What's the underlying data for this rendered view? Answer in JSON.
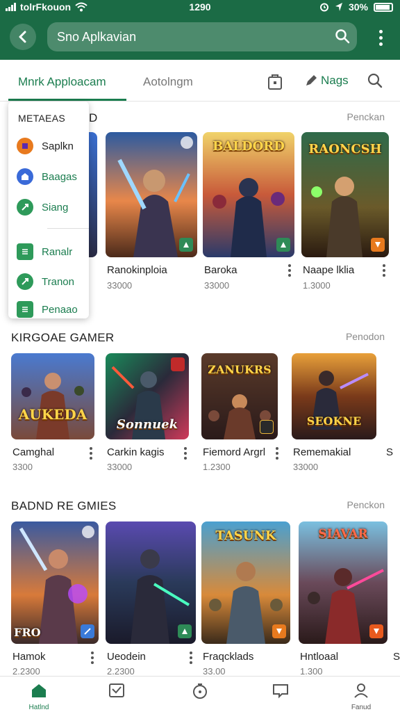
{
  "status_bar": {
    "carrier": "tolrFkouon",
    "time": "1290",
    "battery": "30%"
  },
  "header": {
    "search_text": "Sno Aplkavian",
    "back_icon": "back-arrow-icon",
    "search_icon": "search-icon",
    "menu_icon": "more-vert-icon",
    "color": "#1b6b45"
  },
  "tabs": {
    "active": "Mnrk Apploacam",
    "second": "Aotolngm",
    "nags": "Nags",
    "accent": "#1b7d4f"
  },
  "popup": {
    "title": "METAEAS",
    "items": [
      {
        "label": "Saplkn",
        "icon": "app-icon"
      },
      {
        "label": "Baagas",
        "icon": "store-icon"
      },
      {
        "label": "Siang",
        "icon": "rocket-icon"
      },
      {
        "label": "Ranalr",
        "icon": "list-icon"
      },
      {
        "label": "Tranon",
        "icon": "rocket-icon"
      },
      {
        "label": "Penaao",
        "icon": "list-icon"
      }
    ]
  },
  "sections": [
    {
      "title": "D",
      "link": "Penckan",
      "cards": [
        {
          "name": "Ranokinploia",
          "size": "33000"
        },
        {
          "name": "Baroka",
          "size": "33000"
        },
        {
          "name": "Naape lklia",
          "size": "1.3000"
        }
      ]
    },
    {
      "title": "KIRGOAE GAMER",
      "link": "Penodon",
      "cards": [
        {
          "name": "Camghal",
          "size": "3300"
        },
        {
          "name": "Carkin kagis",
          "size": "33000"
        },
        {
          "name": "Fiemord Argrl",
          "size": "1.2300"
        },
        {
          "name": "Rememakial",
          "size": "33000"
        }
      ]
    },
    {
      "title": "BADND RE GMIES",
      "link": "Penckon",
      "cards": [
        {
          "name": "Hamok",
          "size": "2.2300"
        },
        {
          "name": "Ueodein",
          "size": "2.2300"
        },
        {
          "name": "Fraqcklads",
          "size": "33.00"
        },
        {
          "name": "Hntloaal",
          "size": "1.300"
        }
      ]
    }
  ],
  "thumb_logos": {
    "r1c2": "BALDORD",
    "r1c3": "RAONCSH",
    "r2c1": "AUKEDA",
    "r2c2": "Sonnuek",
    "r2c3": "ZANUKRS",
    "r2c4": "SEOKNE",
    "r3c1": "FRO",
    "r3c3": "TASUNK",
    "r3c4": "SIAVAR"
  },
  "bottom_nav": [
    {
      "label": "Hatlnd",
      "icon": "home-icon"
    },
    {
      "label": "",
      "icon": "chart-icon"
    },
    {
      "label": "",
      "icon": "timer-icon"
    },
    {
      "label": "",
      "icon": "chat-icon"
    },
    {
      "label": "Fanud",
      "icon": "profile-icon"
    }
  ]
}
